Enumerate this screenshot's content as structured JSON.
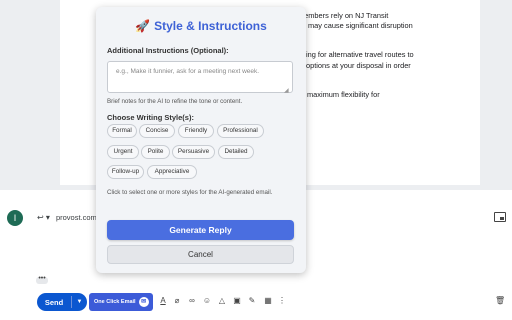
{
  "email_body": {
    "lines": [
      "members rely on NJ Transit",
      "may cause significant disruption",
      "ing for alternative travel routes to",
      "options at your disposal in order",
      "maximum flexibility for"
    ]
  },
  "compose": {
    "avatar_letter": "I",
    "reply_icon": "reply-icon",
    "recipient": "provost.com",
    "ellipsis": "•••",
    "send_label": "Send",
    "one_click_label": "One Click Email",
    "toolbar_icons": [
      "format-text-icon",
      "attach-icon",
      "link-icon",
      "emoji-icon",
      "drive-icon",
      "photo-icon",
      "signature-icon",
      "schedule-icon",
      "more-options-icon"
    ],
    "trash_icon": "trash-icon"
  },
  "popup": {
    "title": "Style & Instructions",
    "instructions_label": "Additional Instructions (Optional):",
    "instructions_placeholder": "e.g., Make it funnier, ask for a meeting next week.",
    "instructions_hint": "Brief notes for the AI to refine the tone or content.",
    "styles_label": "Choose Writing Style(s):",
    "styles": [
      "Formal",
      "Concise",
      "Friendly",
      "Professional",
      "Urgent",
      "Polite",
      "Persuasive",
      "Detailed",
      "Follow-up",
      "Appreciative"
    ],
    "styles_hint": "Click to select one or more styles for the AI-generated email.",
    "generate_label": "Generate Reply",
    "cancel_label": "Cancel",
    "accent_color": "#3e62d6"
  }
}
